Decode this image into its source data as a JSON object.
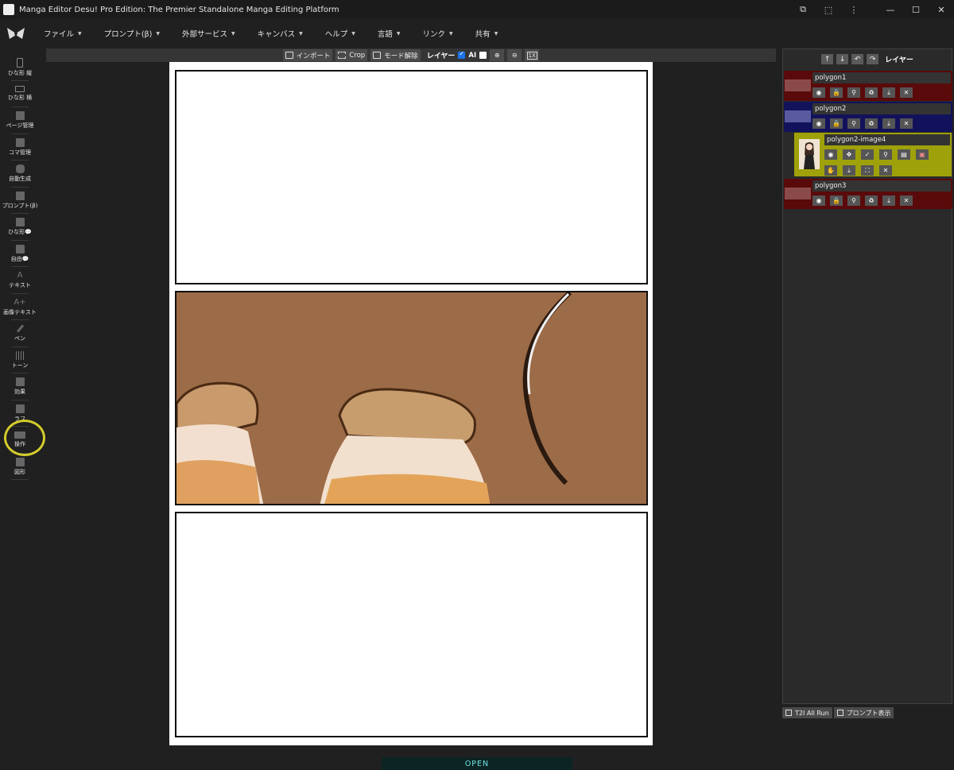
{
  "window": {
    "title": "Manga Editor Desu! Pro Edition: The Premier Standalone Manga Editing Platform"
  },
  "menu": [
    {
      "label": "ファイル"
    },
    {
      "label": "プロンプト(β)"
    },
    {
      "label": "外部サービス"
    },
    {
      "label": "キャンバス"
    },
    {
      "label": "ヘルプ"
    },
    {
      "label": "言語"
    },
    {
      "label": "リンク"
    },
    {
      "label": "共有"
    }
  ],
  "tools": [
    {
      "label": "ひな形 縦",
      "icon": "portrait-template-icon"
    },
    {
      "label": "ひな形 横",
      "icon": "landscape-template-icon"
    },
    {
      "label": "ページ管理",
      "icon": "page-grid-icon"
    },
    {
      "label": "コマ管理",
      "icon": "panel-grid-icon"
    },
    {
      "label": "自動生成",
      "icon": "robot-icon"
    },
    {
      "label": "プロンプト(β)",
      "icon": "clipboard-icon"
    },
    {
      "label": "ひな形💬",
      "icon": "speech-bubble-icon"
    },
    {
      "label": "自由💬",
      "icon": "add-bubble-icon"
    },
    {
      "label": "テキスト",
      "icon": "text-icon"
    },
    {
      "label": "画像テキスト",
      "icon": "image-text-icon"
    },
    {
      "label": "ペン",
      "icon": "brush-icon"
    },
    {
      "label": "トーン",
      "icon": "tone-icon"
    },
    {
      "label": "効果",
      "icon": "effect-icon"
    },
    {
      "label": "ラフ",
      "icon": "rough-icon"
    },
    {
      "label": "操作",
      "icon": "operation-icon"
    },
    {
      "label": "図形",
      "icon": "shapes-icon"
    }
  ],
  "canvas_toolbar": {
    "import_label": "インポート",
    "crop_label": "Crop",
    "mode_off_label": "モード解除",
    "layer_label": "レイヤー",
    "layer_checked": true,
    "ai_label": "AI",
    "ai_checked": false,
    "zoom_in": "zoom-in-icon",
    "zoom_out": "zoom-out-icon",
    "fit_label": "1X"
  },
  "layers_panel": {
    "title": "レイヤー",
    "layers": [
      {
        "name": "polygon1",
        "color": "#5a0a0a"
      },
      {
        "name": "polygon2",
        "color": "#12125c"
      },
      {
        "name": "polygon2-image4",
        "color": "#9fa10a"
      },
      {
        "name": "polygon3",
        "color": "#5a0a0a"
      }
    ]
  },
  "bottom_buttons": {
    "t2i_label": "T2I All Run",
    "prompt_label": "プロンプト表示"
  },
  "footer": {
    "open_label": "OPEN"
  }
}
